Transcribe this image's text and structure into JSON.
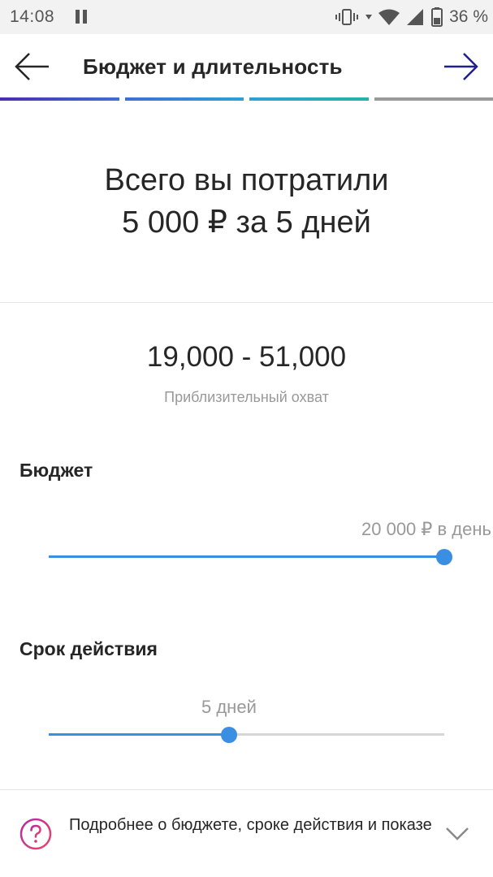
{
  "status_bar": {
    "time": "14:08",
    "battery": "36 %"
  },
  "header": {
    "title": "Бюджет и длительность"
  },
  "summary": {
    "line1": "Всего вы потратили",
    "line2": "5 000 ₽ за 5 дней"
  },
  "reach": {
    "range": "19,000 - 51,000",
    "label": "Приблизительный охват"
  },
  "budget": {
    "label": "Бюджет",
    "value_text": "20 000 ₽ в день",
    "level": 1.0
  },
  "duration": {
    "label": "Срок действия",
    "value_text": "5 дней",
    "level": 0.455
  },
  "info": {
    "text": "Подробнее о бюджете, сроке действия и показе"
  },
  "colors": {
    "accent": "#3b8fe3",
    "help_gradient_start": "#b52aa0",
    "help_gradient_end": "#e8456b"
  }
}
